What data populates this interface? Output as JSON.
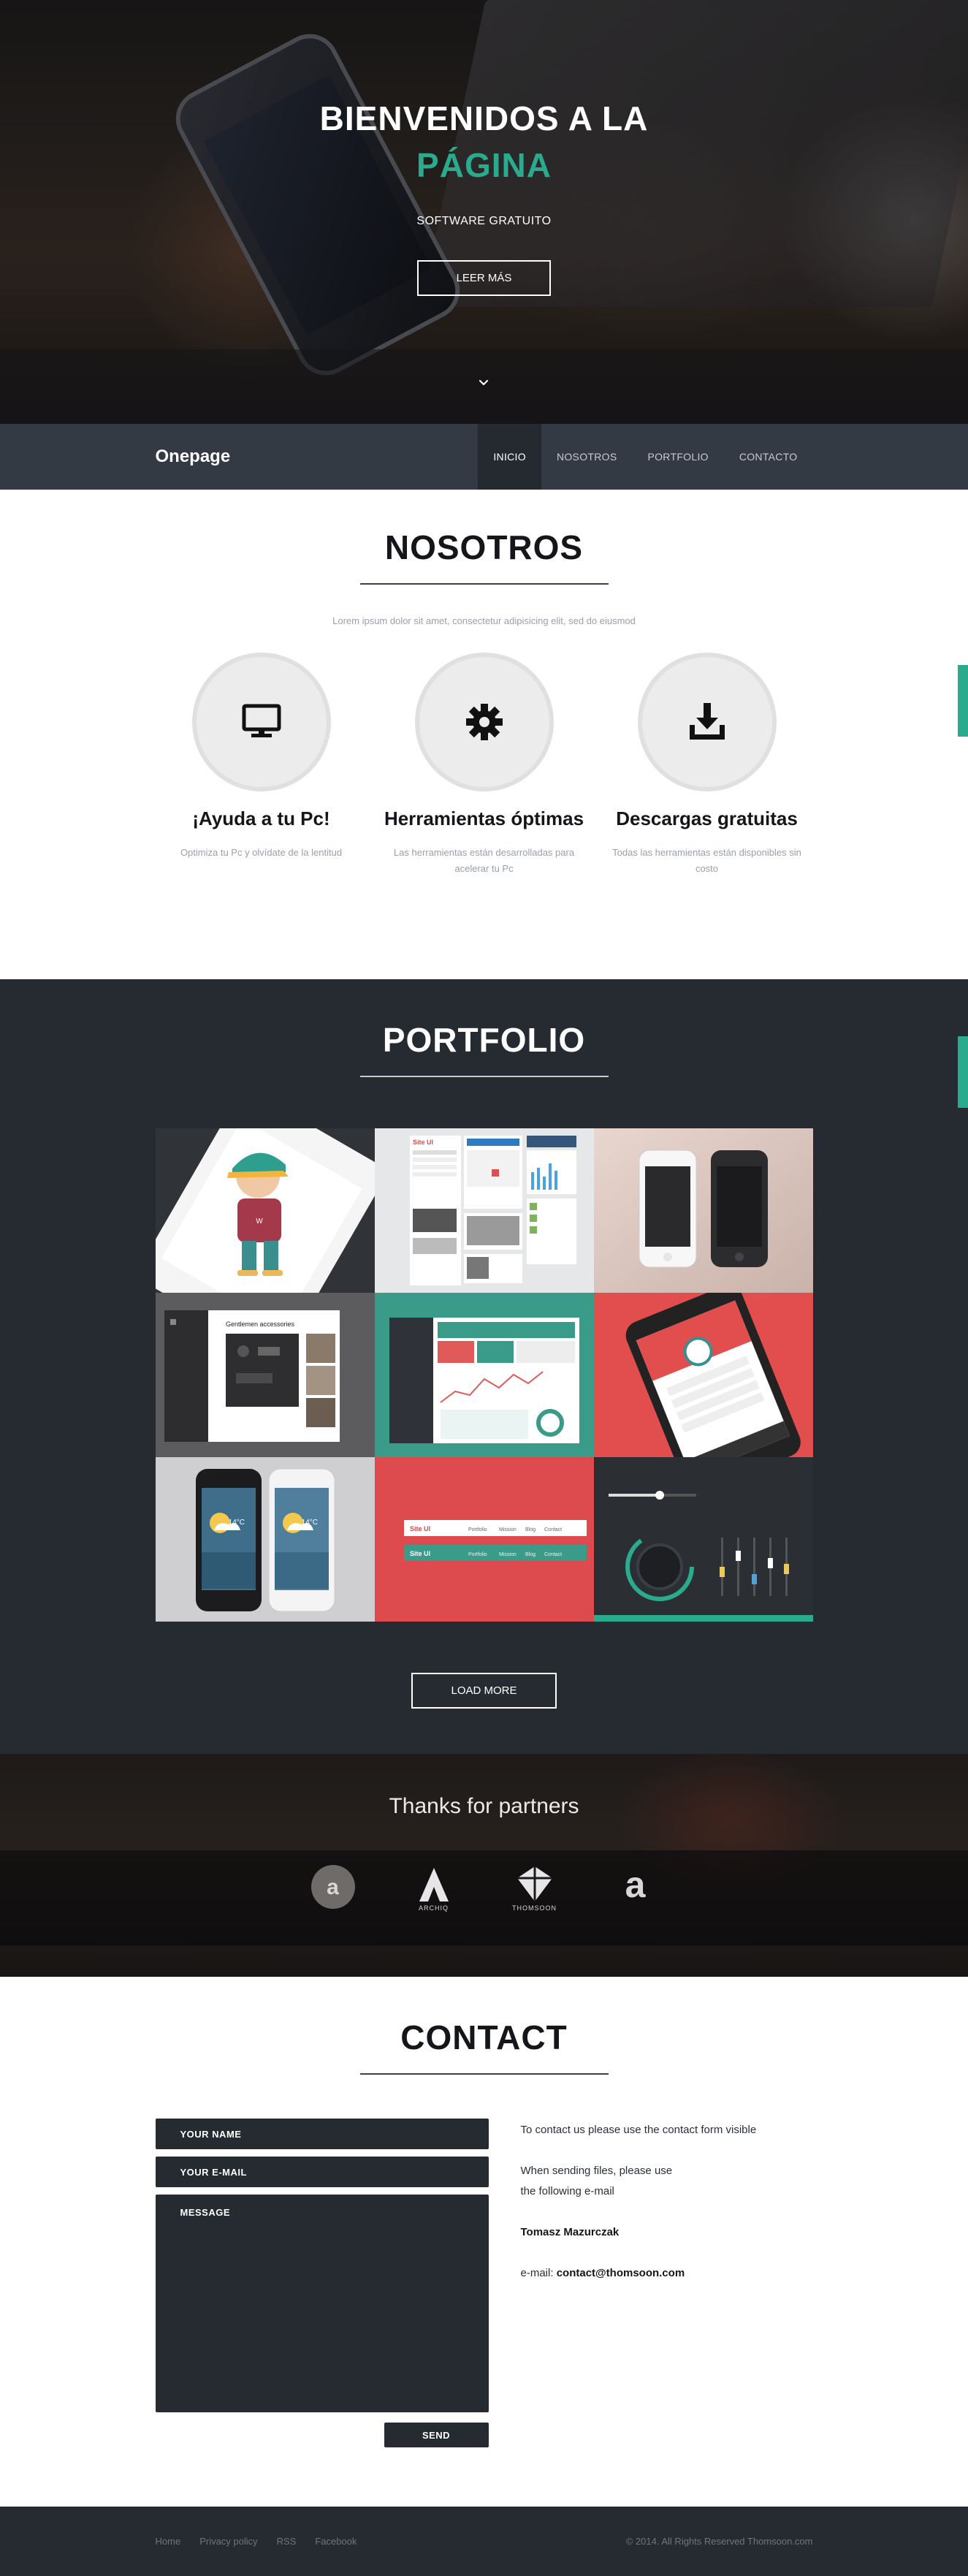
{
  "hero": {
    "title_line1": "BIENVENIDOS A LA",
    "title_line2": "PÁGINA",
    "subtitle": "SOFTWARE GRATUITO",
    "button": "LEER MÁS",
    "scroll_icon": "chevron-down-icon"
  },
  "nav": {
    "brand": "Onepage",
    "items": [
      {
        "label": "INICIO",
        "active": true
      },
      {
        "label": "NOSOTROS",
        "active": false
      },
      {
        "label": "PORTFOLIO",
        "active": false
      },
      {
        "label": "CONTACTO",
        "active": false
      }
    ]
  },
  "nosotros": {
    "title": "NOSOTROS",
    "lead": "Lorem ipsum dolor sit amet, consectetur adipisicing elit, sed do eiusmod",
    "features": [
      {
        "icon": "monitor-icon",
        "title": "¡Ayuda a tu Pc!",
        "text": "Optimiza tu Pc y olvídate de la lentitud"
      },
      {
        "icon": "gear-icon",
        "title": "Herramientas óptimas",
        "text": "Las herramientas están desarrolladas para acelerar tu Pc"
      },
      {
        "icon": "download-icon",
        "title": "Descargas gratuitas",
        "text": "Todas las herramientas están disponibles sin costo"
      }
    ]
  },
  "portfolio": {
    "title": "PORTFOLIO",
    "load_more": "LOAD MORE",
    "tiles": [
      {
        "kind": "character-phone"
      },
      {
        "kind": "site-ui-kit",
        "label": "Site UI"
      },
      {
        "kind": "white-black-iphones"
      },
      {
        "kind": "gentlemen-accessories",
        "label": "Gentlemen accessories"
      },
      {
        "kind": "dashboard-ui"
      },
      {
        "kind": "red-mobile-app"
      },
      {
        "kind": "weather-phones",
        "temp": "14°C"
      },
      {
        "kind": "site-ui-menus",
        "label": "Site UI",
        "menu": [
          "Portfolio",
          "Mission",
          "Blog",
          "Contact"
        ]
      },
      {
        "kind": "audio-knob-ui"
      }
    ]
  },
  "partners": {
    "title": "Thanks for partners",
    "logos": [
      {
        "icon": "letter-a-circle-icon",
        "caption": ""
      },
      {
        "icon": "archiq-logo-icon",
        "caption": "ARCHIQ"
      },
      {
        "icon": "thomsoon-logo-icon",
        "caption": "THOMSOON"
      },
      {
        "icon": "letter-a-icon",
        "caption": ""
      }
    ]
  },
  "contact": {
    "title": "CONTACT",
    "name_label": "YOUR NAME",
    "email_label": "YOUR E-MAIL",
    "message_label": "MESSAGE",
    "send": "SEND",
    "info_line1": "To contact us please use the contact form visible",
    "info_line2a": "When sending files, please use",
    "info_line2b": "the following e-mail",
    "person": "Tomasz Mazurczak",
    "email_prefix": "e-mail:",
    "email": "contact@thomsoon.com"
  },
  "footer": {
    "links": [
      "Home",
      "Privacy policy",
      "RSS",
      "Facebook"
    ],
    "copyright": "© 2014. All Rights Reserved Thomsoon.com"
  },
  "colors": {
    "accent": "#2bab8e",
    "dark": "#262b31",
    "nav": "#343a44"
  }
}
